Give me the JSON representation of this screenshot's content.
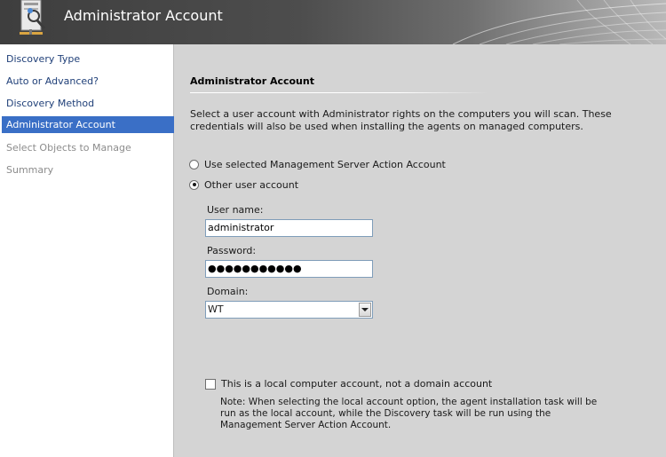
{
  "header": {
    "title": "Administrator Account",
    "icon": "wizard-user-search-icon"
  },
  "nav": {
    "items": [
      {
        "label": "Discovery Type",
        "state": "enabled"
      },
      {
        "label": "Auto or Advanced?",
        "state": "enabled"
      },
      {
        "label": "Discovery Method",
        "state": "enabled"
      },
      {
        "label": "Administrator Account",
        "state": "selected"
      },
      {
        "label": "Select Objects to Manage",
        "state": "disabled"
      },
      {
        "label": "Summary",
        "state": "disabled"
      }
    ]
  },
  "main": {
    "section_title": "Administrator Account",
    "description": "Select a user account with Administrator rights on the computers you will scan. These credentials will also be used when installing the agents on managed computers.",
    "options": [
      {
        "label": "Use selected Management Server Action Account",
        "checked": false
      },
      {
        "label": "Other user account",
        "checked": true
      }
    ],
    "username_label": "User name:",
    "username_value": "administrator",
    "password_label": "Password:",
    "password_value": "●●●●●●●●●●●",
    "domain_label": "Domain:",
    "domain_value": "WT",
    "local_account_label": "This is a local computer account, not a domain account",
    "local_account_checked": false,
    "note": "Note:  When selecting the local account option, the agent installation task will be run as the local account, while the Discovery task will be run using the Management Server Action Account."
  },
  "colors": {
    "selected_nav_bg": "#3a6fc6",
    "nav_link": "#1f3f78",
    "content_bg": "#d4d4d4"
  }
}
